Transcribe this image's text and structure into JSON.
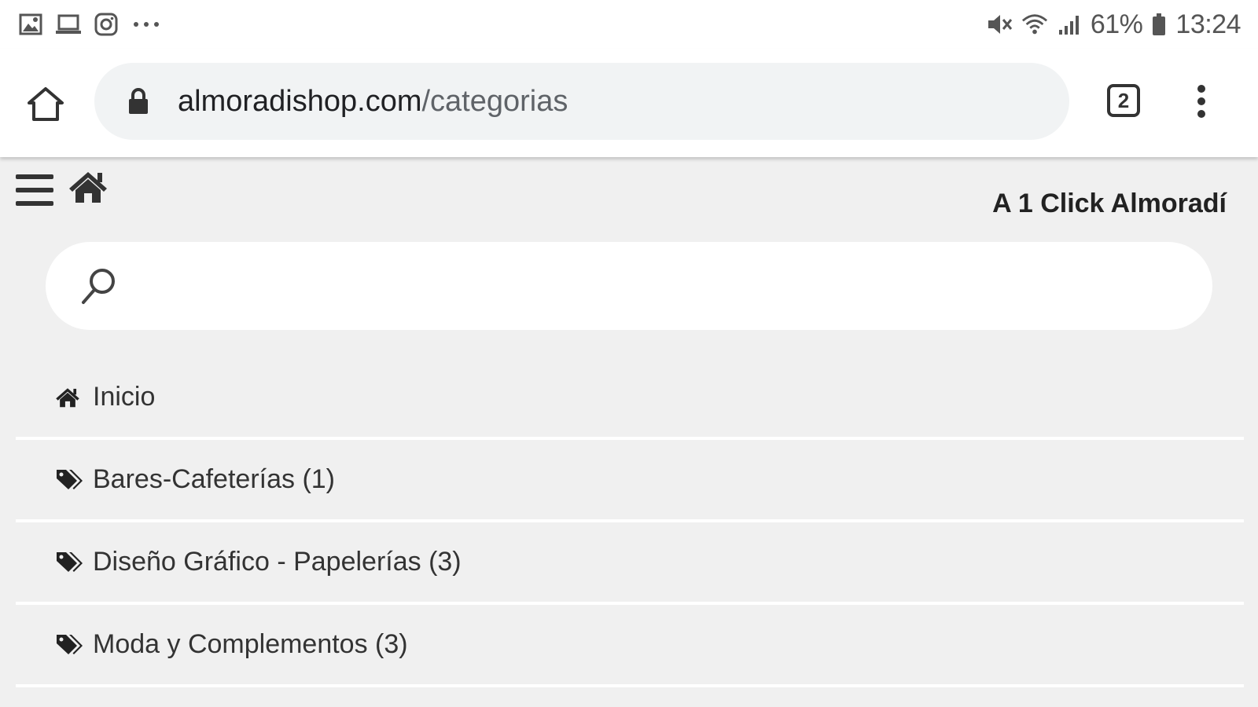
{
  "status_bar": {
    "left_icons": [
      "gallery-icon",
      "laptop-icon",
      "instagram-icon",
      "more-notifications-icon"
    ],
    "battery": "61%",
    "time": "13:24"
  },
  "browser": {
    "url_host": "almoradishop.com",
    "url_path": "/categorias",
    "tab_count": "2"
  },
  "site": {
    "title": "A 1 Click Almoradí"
  },
  "search": {
    "value": "",
    "placeholder": ""
  },
  "categories": [
    {
      "label": "Inicio",
      "icon": "home-icon"
    },
    {
      "label": "Bares-Cafeterías (1)",
      "icon": "tags-icon"
    },
    {
      "label": "Diseño Gráfico - Papelerías (3)",
      "icon": "tags-icon"
    },
    {
      "label": "Moda y Complementos (3)",
      "icon": "tags-icon"
    }
  ]
}
